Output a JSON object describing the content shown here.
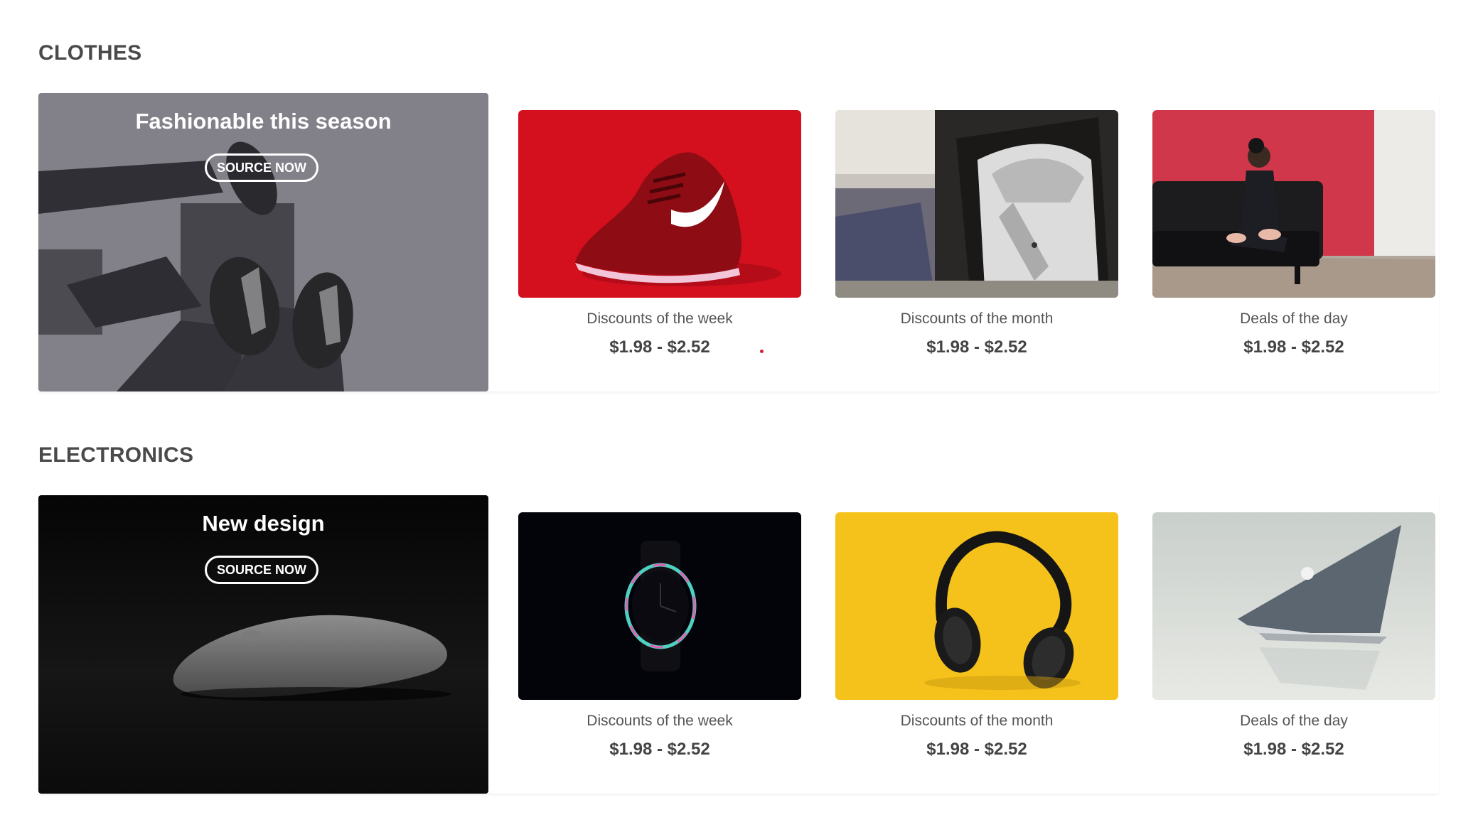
{
  "sections": [
    {
      "title": "CLOTHES",
      "banner": {
        "title": "Fashionable this season",
        "button_label": "SOURCE NOW",
        "image": "sneakers-feet-photo"
      },
      "cards": [
        {
          "caption": "Discounts of the week",
          "price": "$1.98 - $2.52",
          "image": "red-sneaker-photo"
        },
        {
          "caption": "Discounts of the month",
          "price": "$1.98 - $2.52",
          "image": "shirt-box-photo"
        },
        {
          "caption": "Deals of the day",
          "price": "$1.98 - $2.52",
          "image": "woman-on-sofa-photo"
        }
      ]
    },
    {
      "title": "ELECTRONICS",
      "banner": {
        "title": "New design",
        "button_label": "SOURCE NOW",
        "image": "magic-mouse-photo"
      },
      "cards": [
        {
          "caption": "Discounts of the week",
          "price": "$1.98 - $2.52",
          "image": "watch-photo"
        },
        {
          "caption": "Discounts of the month",
          "price": "$1.98 - $2.52",
          "image": "headphones-photo"
        },
        {
          "caption": "Deals of the day",
          "price": "$1.98 - $2.52",
          "image": "laptop-photo"
        }
      ]
    }
  ],
  "colors": {
    "accent_dot": "#d0202e",
    "heading": "#4a4a4a",
    "text": "#555555"
  }
}
